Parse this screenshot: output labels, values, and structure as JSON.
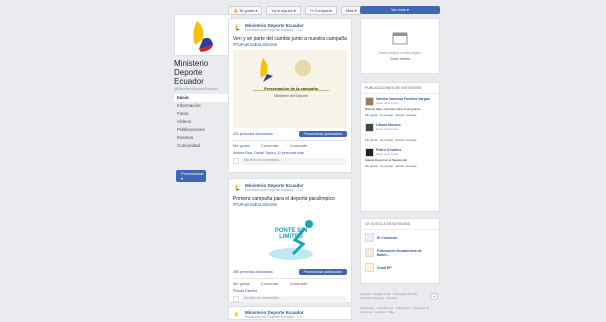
{
  "topbar": {
    "liked": "Te gusta",
    "following": "Ya lo sigues",
    "share": "Compartir",
    "more": "Más"
  },
  "profile": {
    "name": "Ministerio Deporte Ecuador",
    "handle": "@MinisterioDeporteEcuador"
  },
  "nav": {
    "items": [
      "Inicio",
      "Información",
      "Fotos",
      "Vídeos",
      "Publicaciones",
      "Eventos",
      "Comunidad"
    ],
    "promote": "Promocionar"
  },
  "posts": [
    {
      "author": "Ministerio Deporte Ecuador",
      "meta": "Publicado por Deporte Ecuador · 1 h",
      "text": "Ven y sé parte del cambio junto a nuestra campaña",
      "hashtag": "#TuFuerzaEsLaGente",
      "poster_title": "Presentación de la campaña",
      "poster_sub": "Ministerio del Deporte",
      "reach": "321 personas alcanzadas",
      "promote": "Promocionar publicación",
      "actions": [
        "Me gusta",
        "Comentar",
        "Compartir"
      ],
      "likes": "Andrea Ruiz, Daniel Tapia y 12 personas más",
      "comment_placeholder": "Escribe un comentario..."
    },
    {
      "author": "Ministerio Deporte Ecuador",
      "meta": "Publicado por Deporte Ecuador · 2 h",
      "text": "Primera campaña para el deporte paralímpico",
      "hashtag": "#TuFuerzaEsLaGente",
      "graphic_text": "PONTE SIN LIMITES",
      "reach": "285 personas alcanzadas",
      "promote": "Promocionar publicación",
      "actions": [
        "Me gusta",
        "Comentar",
        "Compartir"
      ],
      "likes": "Priscila Estrella",
      "comment_placeholder": "Escribe un comentario..."
    }
  ],
  "post3": {
    "author": "Ministerio Deporte Ecuador",
    "meta": "Publicado por Deporte Ecuador · 3 h"
  },
  "right": {
    "top_button": "Ver más",
    "invite_text": "Invita amigos a esta página",
    "create_event": "Crear evento",
    "visitor_posts_title": "PUBLICACIONES DE VISITANTES",
    "visitors": [
      {
        "name": "Sandra Vanessa Fuentes Vargas",
        "time": "Hace unas horas",
        "text": "Buenos días, consulta sobre el programa...",
        "actions": "Me gusta · Comentar · Enviar mensaje"
      },
      {
        "name": "Liliana Moreno",
        "time": "Hace unas horas",
        "text": "",
        "actions": "Me gusta · Comentar · Enviar mensaje"
      },
      {
        "name": "Pedro Cevallos",
        "time": "Hace unas horas",
        "text": "Saludo Deportivo al Taekwondo",
        "actions": "Me gusta · Comentar · Enviar mensaje"
      }
    ],
    "liked_pages_title": "LE GUSTA A ESTA PÁGINA",
    "liked_pages": [
      "El Comercio",
      "Federación Ecuatoriana de Balon...",
      "Cradi EP"
    ],
    "footer_lang": "Español · English (US) · Português (Brasil) · Français (France) · Deutsch",
    "footer_links": "Privacidad · Condiciones · Publicidad · Opciones de anuncios · Cookies · Más"
  }
}
